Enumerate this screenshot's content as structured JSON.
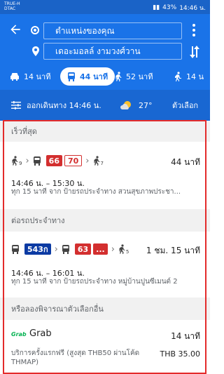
{
  "status_bar": {
    "carrier_line1": "TRUE-H",
    "carrier_line2": "DTAC",
    "battery": "43%",
    "time": "14:46 น."
  },
  "header": {
    "origin_value": "ตำแหน่งของคุณ",
    "destination_value": "เดอะมอลล์ งามวงศ์วาน"
  },
  "modes": [
    {
      "name": "driving",
      "label": "14 นาที",
      "active": false
    },
    {
      "name": "transit",
      "label": "44 นาที",
      "active": true
    },
    {
      "name": "walking",
      "label": "52 นาที",
      "active": false
    },
    {
      "name": "ride",
      "label": "14 น",
      "active": false
    }
  ],
  "subbar": {
    "depart_label": "ออกเดินทาง 14:46 น.",
    "temperature": "27°",
    "options_label": "ตัวเลือก"
  },
  "sections": {
    "fastest": "เร็วที่สุด",
    "less_walking": "ต่อรถประจำทาง",
    "other_options": "หรือลองพิจารณาตัวเลือกอื่น"
  },
  "routes": [
    {
      "walk1_sub": "9",
      "bus_lines": [
        "66",
        "70"
      ],
      "walk2_sub": "7",
      "duration": "44 นาที",
      "time_range": "14:46 น. – 15:30 น.",
      "description": "ทุก 15 นาที จาก ป้ายรถประจำทาง สวนสุขภาพประชา..."
    },
    {
      "bus_line_a": "543ก",
      "bus_line_b": "63",
      "bus_line_more": "...",
      "walk_sub": "5",
      "duration": "1 ชม. 15 นาที",
      "time_range": "14:46 น. – 16:01 น.",
      "description": "ทุก 15 นาที จาก ป้ายรถประจำทาง หมู่บ้านปูนซีเมนต์ 2"
    }
  ],
  "grab": {
    "logo_text": "Grab",
    "name": "Grab",
    "duration": "14 นาที",
    "promo_line1": "บริการครั้งแรกฟรี (สูงสุด THB50 ผ่านโค้ด",
    "promo_line2": "THMAP)",
    "price": "THB 35.00"
  },
  "colors": {
    "header_blue": "#1a73e8",
    "subbar_blue": "#1967d2",
    "bus_red": "#d32f2f",
    "bus_blue": "#0b3aa3",
    "highlight_red": "#e32b2b"
  }
}
